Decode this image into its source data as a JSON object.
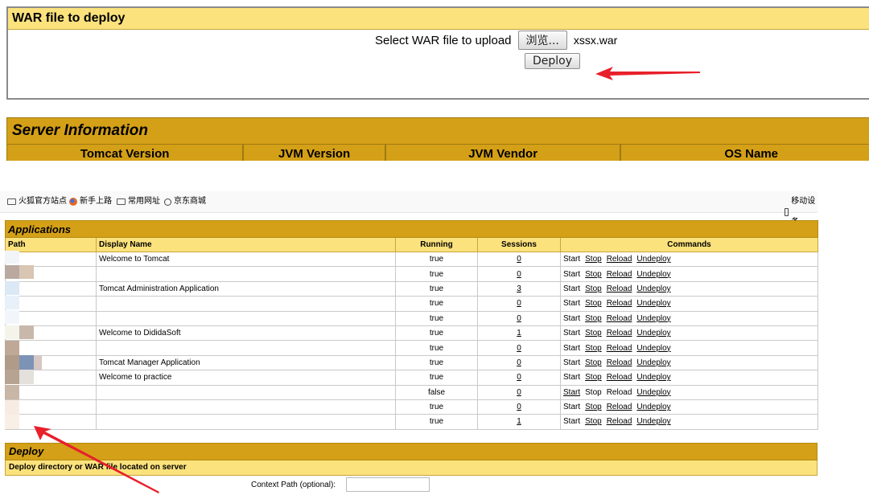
{
  "war": {
    "heading": "WAR file to deploy",
    "select_label": "Select WAR file to upload",
    "browse_button": "浏览...",
    "selected_file": "xssx.war",
    "deploy_button": "Deploy"
  },
  "server_info": {
    "title": "Server Information",
    "columns": [
      "Tomcat Version",
      "JVM Version",
      "JVM Vendor",
      "OS Name"
    ]
  },
  "bookmarks": {
    "items": [
      "火狐官方站点",
      "新手上路",
      "常用网址",
      "京东商城"
    ],
    "right": "移动设备"
  },
  "applications": {
    "title": "Applications",
    "headers": [
      "Path",
      "Display Name",
      "Running",
      "Sessions",
      "Commands"
    ],
    "rows": [
      {
        "display": "Welcome to Tomcat",
        "running": "true",
        "sessions": "0"
      },
      {
        "display": "",
        "running": "true",
        "sessions": "0"
      },
      {
        "display": "Tomcat Administration Application",
        "running": "true",
        "sessions": "3"
      },
      {
        "display": "",
        "running": "true",
        "sessions": "0"
      },
      {
        "display": "",
        "running": "true",
        "sessions": "0"
      },
      {
        "display": "Welcome to DididaSoft",
        "running": "true",
        "sessions": "1"
      },
      {
        "display": "",
        "running": "true",
        "sessions": "0"
      },
      {
        "display": "Tomcat Manager Application",
        "running": "true",
        "sessions": "0"
      },
      {
        "display": "Welcome to practice",
        "running": "true",
        "sessions": "0"
      },
      {
        "display": "",
        "running": "false",
        "sessions": "0"
      },
      {
        "display": "",
        "running": "true",
        "sessions": "0"
      },
      {
        "display": "",
        "running": "true",
        "sessions": "1"
      }
    ],
    "commands": {
      "start": "Start",
      "stop": "Stop",
      "reload": "Reload",
      "undeploy": "Undeploy"
    }
  },
  "deploy": {
    "title": "Deploy",
    "subtitle": "Deploy directory or WAR file located on server",
    "context_path_label": "Context Path (optional):"
  },
  "colors": {
    "header_gold": "#d4a017",
    "subheader_yellow": "#fbe27d",
    "arrow_red": "#e8202a"
  }
}
